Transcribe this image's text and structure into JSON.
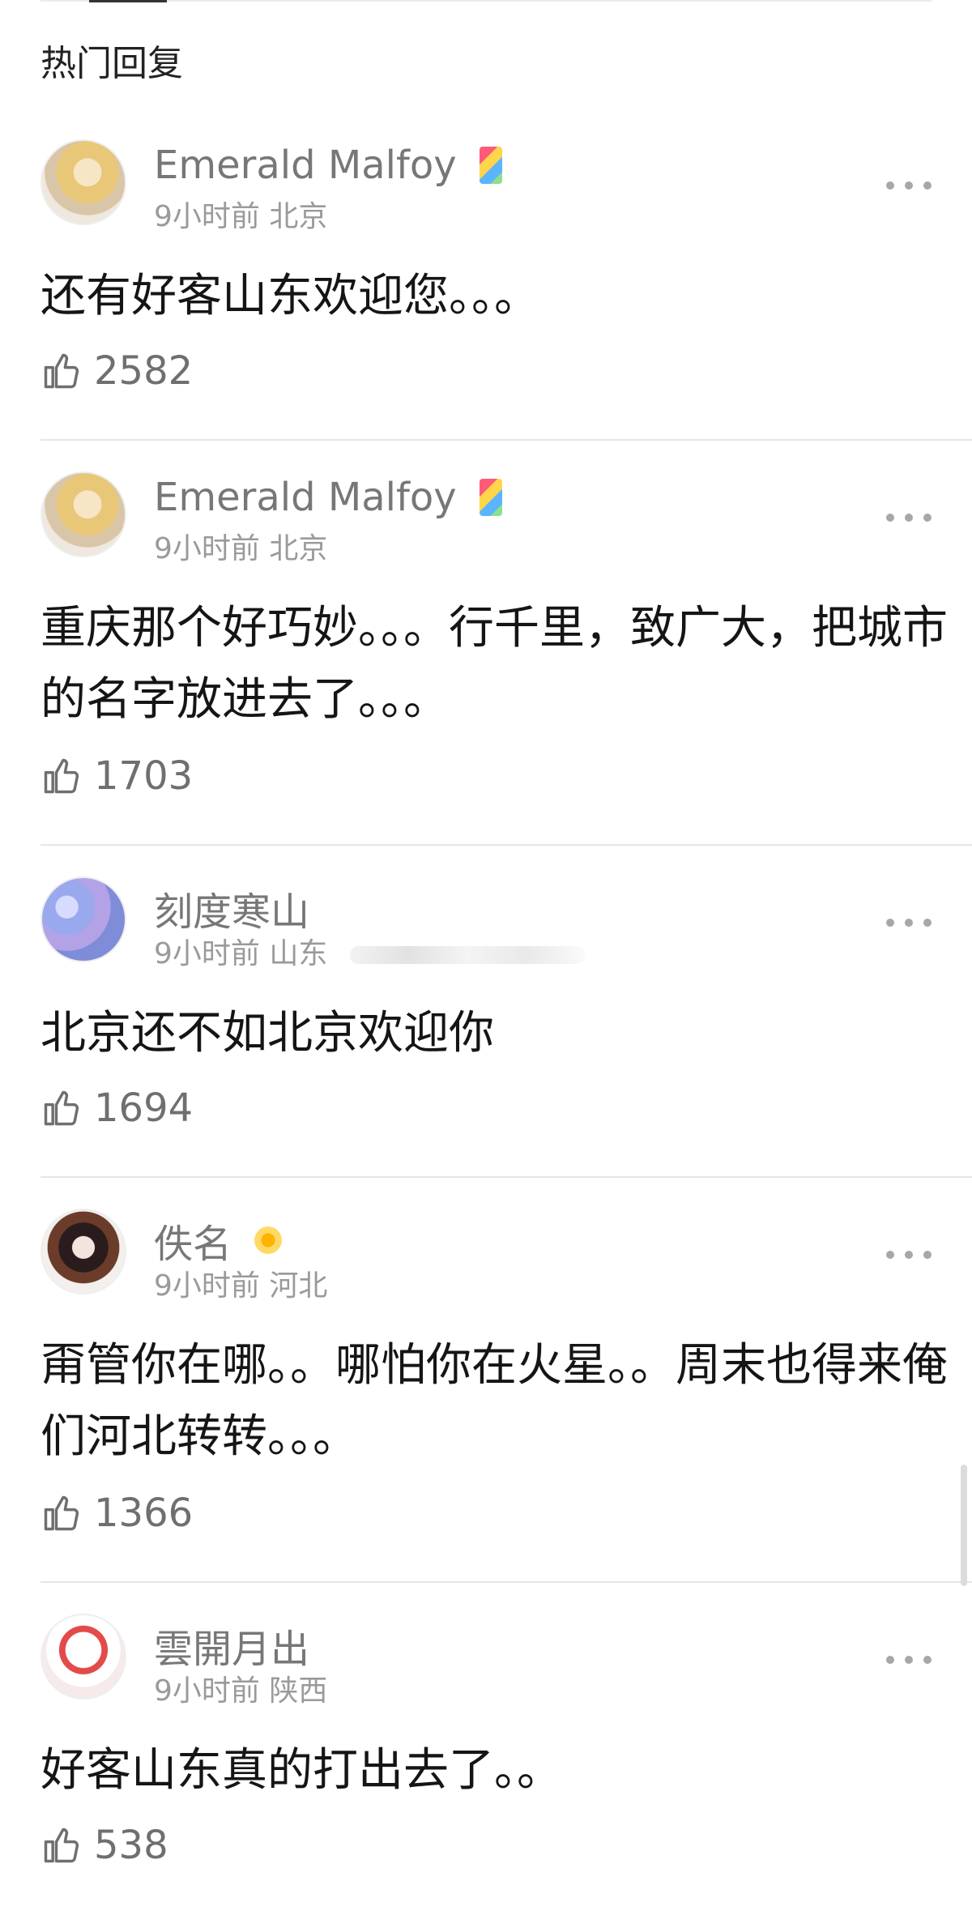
{
  "section": {
    "title": "热门回复"
  },
  "comments": [
    {
      "name": "Emerald Malfoy",
      "time": "9小时前",
      "location": "北京",
      "text": "还有好客山东欢迎您。。。",
      "likes": "2582",
      "badge": "vip-badge-icon"
    },
    {
      "name": "Emerald Malfoy",
      "time": "9小时前",
      "location": "北京",
      "text": "重庆那个好巧妙。。。行千里，致广大，把城市的名字放进去了。。。",
      "likes": "1703",
      "badge": "vip-badge-icon"
    },
    {
      "name": "刻度寒山",
      "time": "9小时前",
      "location": "山东",
      "text": "北京还不如北京欢迎你",
      "likes": "1694"
    },
    {
      "name": "佚名",
      "time": "9小时前",
      "location": "河北",
      "text": "甭管你在哪。。哪怕你在火星。。周末也得来俺们河北转转。。。",
      "likes": "1366",
      "badge": "sunflower-badge-icon"
    },
    {
      "name": "雲開月出",
      "time": "9小时前",
      "location": "陕西",
      "text": "好客山东真的打出去了。。",
      "likes": "538"
    }
  ],
  "colors": {
    "text": "#151515",
    "muted": "#9a9a9a",
    "name": "#777777",
    "divider": "#e6e6e6"
  }
}
